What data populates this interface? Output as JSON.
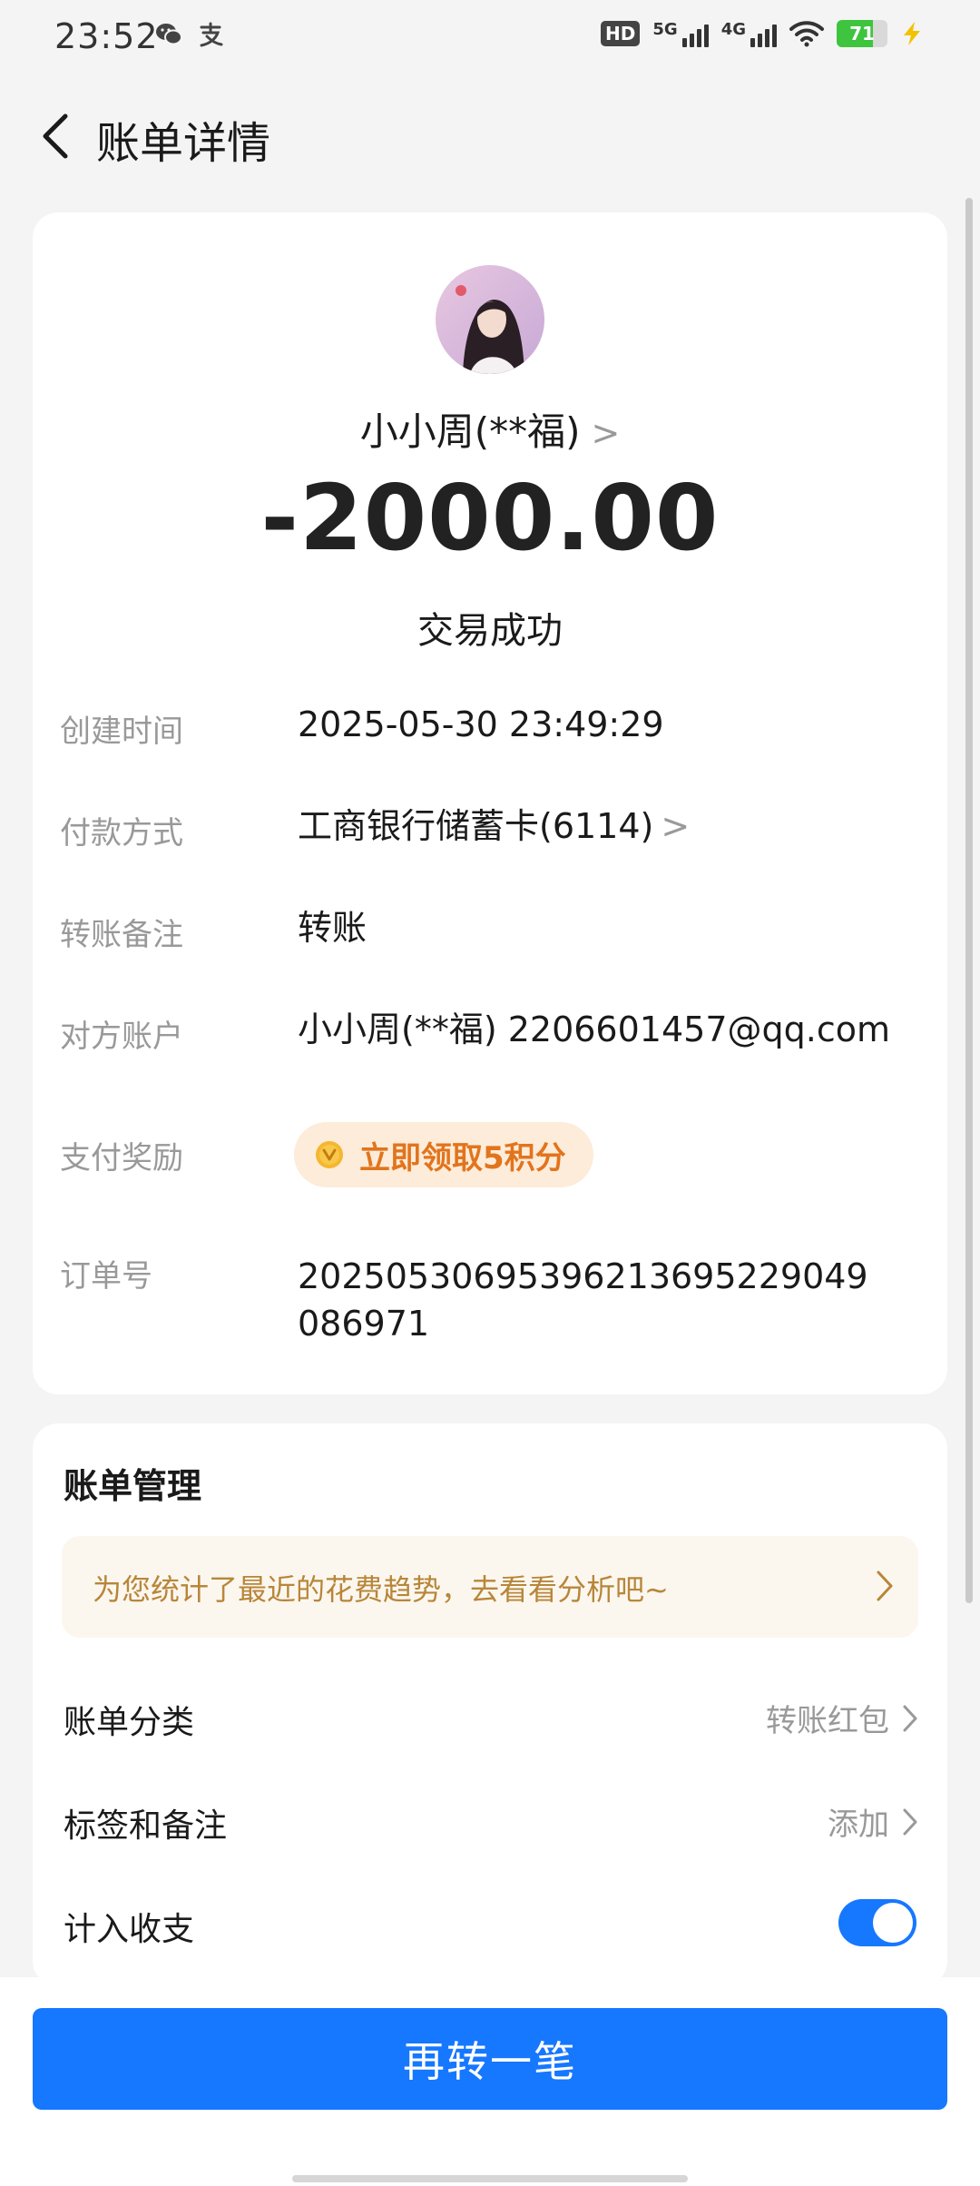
{
  "status_bar": {
    "time": "23:52",
    "hd": "HD",
    "signal_1": "5G",
    "signal_2": "4G",
    "battery": "71",
    "battery_level": 0.71,
    "app_icons": [
      "wechat-icon",
      "alipay-icon"
    ]
  },
  "header": {
    "title": "账单详情"
  },
  "transaction": {
    "name": "小小周(**福)",
    "name_chevron": ">",
    "amount": "-2000.00",
    "status": "交易成功"
  },
  "details": [
    {
      "label": "创建时间",
      "value": "2025-05-30 23:49:29"
    },
    {
      "label": "付款方式",
      "value": "工商银行储蓄卡(6114)",
      "chevron": ">"
    },
    {
      "label": "转账备注",
      "value": "转账"
    },
    {
      "label": "对方账户",
      "value": "小小周(**福) 2206601457@qq.com"
    },
    {
      "label": "支付奖励",
      "value": "立即领取5积分"
    },
    {
      "label": "订单号",
      "value": "20250530695396213695229049086971"
    }
  ],
  "management": {
    "title": "账单管理",
    "tip": "为您统计了最近的花费趋势，去看看分析吧~",
    "rows": [
      {
        "label": "账单分类",
        "value": "转账红包"
      },
      {
        "label": "标签和备注",
        "value": "添加"
      },
      {
        "label": "计入收支",
        "toggle_on": true
      }
    ]
  },
  "cta": {
    "label": "再转一笔"
  },
  "colors": {
    "accent": "#1677ff",
    "reward_text": "#e2741d",
    "reward_bg": "#fdecd9",
    "tip_text": "#b88639",
    "battery_green": "#3ec43e"
  }
}
